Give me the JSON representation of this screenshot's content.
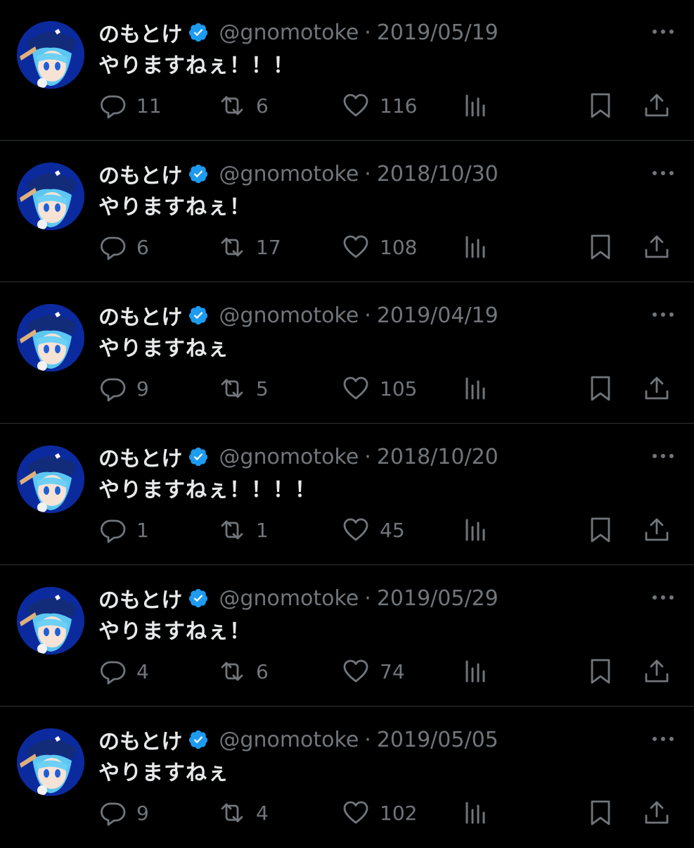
{
  "colors": {
    "background": "#000000",
    "divider": "#2f3336",
    "primary_text": "#e7e9ea",
    "secondary_text": "#71767b",
    "verified_badge": "#1d9bf0"
  },
  "icons": {
    "verified": "verified-badge-icon",
    "more": "more-dots-icon",
    "reply": "reply-bubble-icon",
    "retweet": "retweet-arrows-icon",
    "like": "heart-icon",
    "views": "bar-chart-icon",
    "bookmark": "bookmark-icon",
    "share": "share-upload-icon"
  },
  "tweets": [
    {
      "name": "のもとけ",
      "handle": "@gnomotoke",
      "separator": "·",
      "date": "2019/05/19",
      "text": "やりますねぇ！！！",
      "replies": "11",
      "retweets": "6",
      "likes": "116"
    },
    {
      "name": "のもとけ",
      "handle": "@gnomotoke",
      "separator": "·",
      "date": "2018/10/30",
      "text": "やりますねぇ！",
      "replies": "6",
      "retweets": "17",
      "likes": "108"
    },
    {
      "name": "のもとけ",
      "handle": "@gnomotoke",
      "separator": "·",
      "date": "2019/04/19",
      "text": "やりますねぇ",
      "replies": "9",
      "retweets": "5",
      "likes": "105"
    },
    {
      "name": "のもとけ",
      "handle": "@gnomotoke",
      "separator": "·",
      "date": "2018/10/20",
      "text": "やりますねぇ！！！！",
      "replies": "1",
      "retweets": "1",
      "likes": "45"
    },
    {
      "name": "のもとけ",
      "handle": "@gnomotoke",
      "separator": "·",
      "date": "2019/05/29",
      "text": "やりますねぇ！",
      "replies": "4",
      "retweets": "6",
      "likes": "74"
    },
    {
      "name": "のもとけ",
      "handle": "@gnomotoke",
      "separator": "·",
      "date": "2019/05/05",
      "text": "やりますねぇ",
      "replies": "9",
      "retweets": "4",
      "likes": "102"
    }
  ]
}
